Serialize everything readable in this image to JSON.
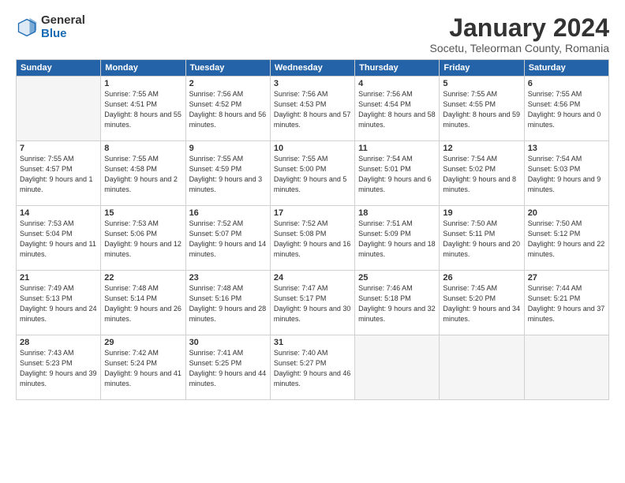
{
  "logo": {
    "general": "General",
    "blue": "Blue"
  },
  "header": {
    "title": "January 2024",
    "subtitle": "Socetu, Teleorman County, Romania"
  },
  "days": [
    "Sunday",
    "Monday",
    "Tuesday",
    "Wednesday",
    "Thursday",
    "Friday",
    "Saturday"
  ],
  "weeks": [
    [
      {
        "day": "",
        "empty": true
      },
      {
        "day": "1",
        "sunrise": "7:55 AM",
        "sunset": "4:51 PM",
        "daylight": "8 hours and 55 minutes."
      },
      {
        "day": "2",
        "sunrise": "7:56 AM",
        "sunset": "4:52 PM",
        "daylight": "8 hours and 56 minutes."
      },
      {
        "day": "3",
        "sunrise": "7:56 AM",
        "sunset": "4:53 PM",
        "daylight": "8 hours and 57 minutes."
      },
      {
        "day": "4",
        "sunrise": "7:56 AM",
        "sunset": "4:54 PM",
        "daylight": "8 hours and 58 minutes."
      },
      {
        "day": "5",
        "sunrise": "7:55 AM",
        "sunset": "4:55 PM",
        "daylight": "8 hours and 59 minutes."
      },
      {
        "day": "6",
        "sunrise": "7:55 AM",
        "sunset": "4:56 PM",
        "daylight": "9 hours and 0 minutes."
      }
    ],
    [
      {
        "day": "7",
        "sunrise": "7:55 AM",
        "sunset": "4:57 PM",
        "daylight": "9 hours and 1 minute."
      },
      {
        "day": "8",
        "sunrise": "7:55 AM",
        "sunset": "4:58 PM",
        "daylight": "9 hours and 2 minutes."
      },
      {
        "day": "9",
        "sunrise": "7:55 AM",
        "sunset": "4:59 PM",
        "daylight": "9 hours and 3 minutes."
      },
      {
        "day": "10",
        "sunrise": "7:55 AM",
        "sunset": "5:00 PM",
        "daylight": "9 hours and 5 minutes."
      },
      {
        "day": "11",
        "sunrise": "7:54 AM",
        "sunset": "5:01 PM",
        "daylight": "9 hours and 6 minutes."
      },
      {
        "day": "12",
        "sunrise": "7:54 AM",
        "sunset": "5:02 PM",
        "daylight": "9 hours and 8 minutes."
      },
      {
        "day": "13",
        "sunrise": "7:54 AM",
        "sunset": "5:03 PM",
        "daylight": "9 hours and 9 minutes."
      }
    ],
    [
      {
        "day": "14",
        "sunrise": "7:53 AM",
        "sunset": "5:04 PM",
        "daylight": "9 hours and 11 minutes."
      },
      {
        "day": "15",
        "sunrise": "7:53 AM",
        "sunset": "5:06 PM",
        "daylight": "9 hours and 12 minutes."
      },
      {
        "day": "16",
        "sunrise": "7:52 AM",
        "sunset": "5:07 PM",
        "daylight": "9 hours and 14 minutes."
      },
      {
        "day": "17",
        "sunrise": "7:52 AM",
        "sunset": "5:08 PM",
        "daylight": "9 hours and 16 minutes."
      },
      {
        "day": "18",
        "sunrise": "7:51 AM",
        "sunset": "5:09 PM",
        "daylight": "9 hours and 18 minutes."
      },
      {
        "day": "19",
        "sunrise": "7:50 AM",
        "sunset": "5:11 PM",
        "daylight": "9 hours and 20 minutes."
      },
      {
        "day": "20",
        "sunrise": "7:50 AM",
        "sunset": "5:12 PM",
        "daylight": "9 hours and 22 minutes."
      }
    ],
    [
      {
        "day": "21",
        "sunrise": "7:49 AM",
        "sunset": "5:13 PM",
        "daylight": "9 hours and 24 minutes."
      },
      {
        "day": "22",
        "sunrise": "7:48 AM",
        "sunset": "5:14 PM",
        "daylight": "9 hours and 26 minutes."
      },
      {
        "day": "23",
        "sunrise": "7:48 AM",
        "sunset": "5:16 PM",
        "daylight": "9 hours and 28 minutes."
      },
      {
        "day": "24",
        "sunrise": "7:47 AM",
        "sunset": "5:17 PM",
        "daylight": "9 hours and 30 minutes."
      },
      {
        "day": "25",
        "sunrise": "7:46 AM",
        "sunset": "5:18 PM",
        "daylight": "9 hours and 32 minutes."
      },
      {
        "day": "26",
        "sunrise": "7:45 AM",
        "sunset": "5:20 PM",
        "daylight": "9 hours and 34 minutes."
      },
      {
        "day": "27",
        "sunrise": "7:44 AM",
        "sunset": "5:21 PM",
        "daylight": "9 hours and 37 minutes."
      }
    ],
    [
      {
        "day": "28",
        "sunrise": "7:43 AM",
        "sunset": "5:23 PM",
        "daylight": "9 hours and 39 minutes."
      },
      {
        "day": "29",
        "sunrise": "7:42 AM",
        "sunset": "5:24 PM",
        "daylight": "9 hours and 41 minutes."
      },
      {
        "day": "30",
        "sunrise": "7:41 AM",
        "sunset": "5:25 PM",
        "daylight": "9 hours and 44 minutes."
      },
      {
        "day": "31",
        "sunrise": "7:40 AM",
        "sunset": "5:27 PM",
        "daylight": "9 hours and 46 minutes."
      },
      {
        "day": "",
        "empty": true
      },
      {
        "day": "",
        "empty": true
      },
      {
        "day": "",
        "empty": true
      }
    ]
  ]
}
